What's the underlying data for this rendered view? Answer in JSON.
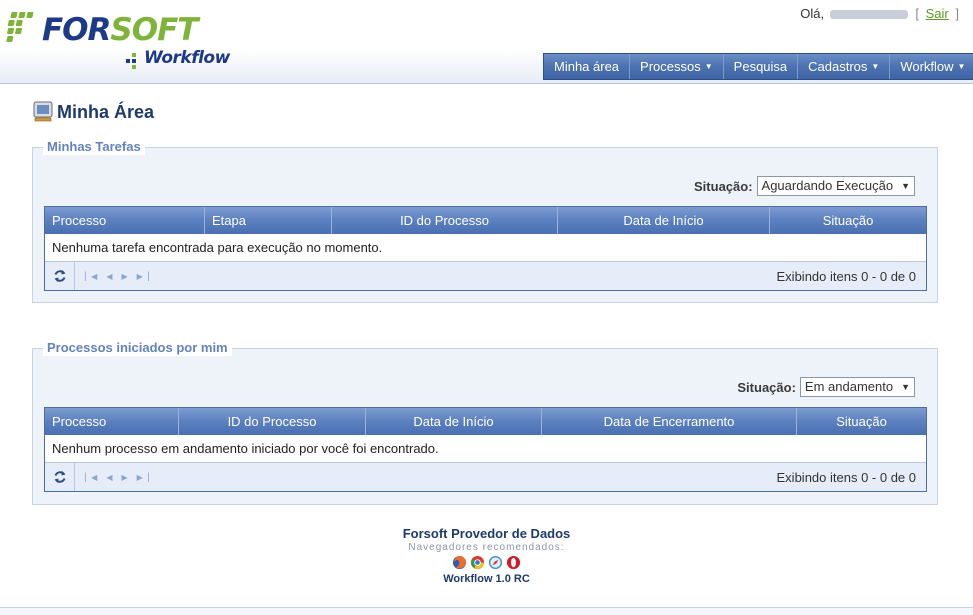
{
  "app": {
    "logo_text_part1": "FOR",
    "logo_text_part2": "SOFT",
    "logo_subtitle": "Workflow"
  },
  "userbar": {
    "greeting": "Olá,",
    "bracket_open": "[",
    "logout": "Sair",
    "bracket_close": "]"
  },
  "menu": {
    "items": [
      {
        "label": "Minha área",
        "dropdown": false
      },
      {
        "label": "Processos",
        "dropdown": true
      },
      {
        "label": "Pesquisa",
        "dropdown": false
      },
      {
        "label": "Cadastros",
        "dropdown": true
      },
      {
        "label": "Workflow",
        "dropdown": true
      }
    ]
  },
  "page": {
    "title": "Minha Área",
    "icon": "monitor-icon"
  },
  "tasks": {
    "legend": "Minhas Tarefas",
    "situacao_label": "Situação:",
    "situacao_value": "Aguardando Execução",
    "columns": [
      "Processo",
      "Etapa",
      "ID do Processo",
      "Data de Início",
      "Situação"
    ],
    "empty_message": "Nenhuma tarefa encontrada para execução no momento.",
    "pager_text": "Exibindo itens 0 - 0 de 0"
  },
  "processes": {
    "legend": "Processos iniciados por mim",
    "situacao_label": "Situação:",
    "situacao_value": "Em andamento",
    "columns": [
      "Processo",
      "ID do Processo",
      "Data de Início",
      "Data de Encerramento",
      "Situação"
    ],
    "empty_message": "Nenhum processo em andamento iniciado por você foi encontrado.",
    "pager_text": "Exibindo itens 0 - 0 de 0"
  },
  "footer": {
    "company": "Forsoft Provedor de Dados",
    "browsers_label": "Navegadores recomendados:",
    "browsers": [
      "firefox-icon",
      "chrome-icon",
      "safari-icon",
      "opera-icon"
    ],
    "version": "Workflow 1.0 RC"
  },
  "colors": {
    "brand_blue": "#1d3a8a",
    "brand_green": "#7fb43a",
    "menu_blue": "#4c72b1",
    "legend_blue": "#6482c0"
  }
}
